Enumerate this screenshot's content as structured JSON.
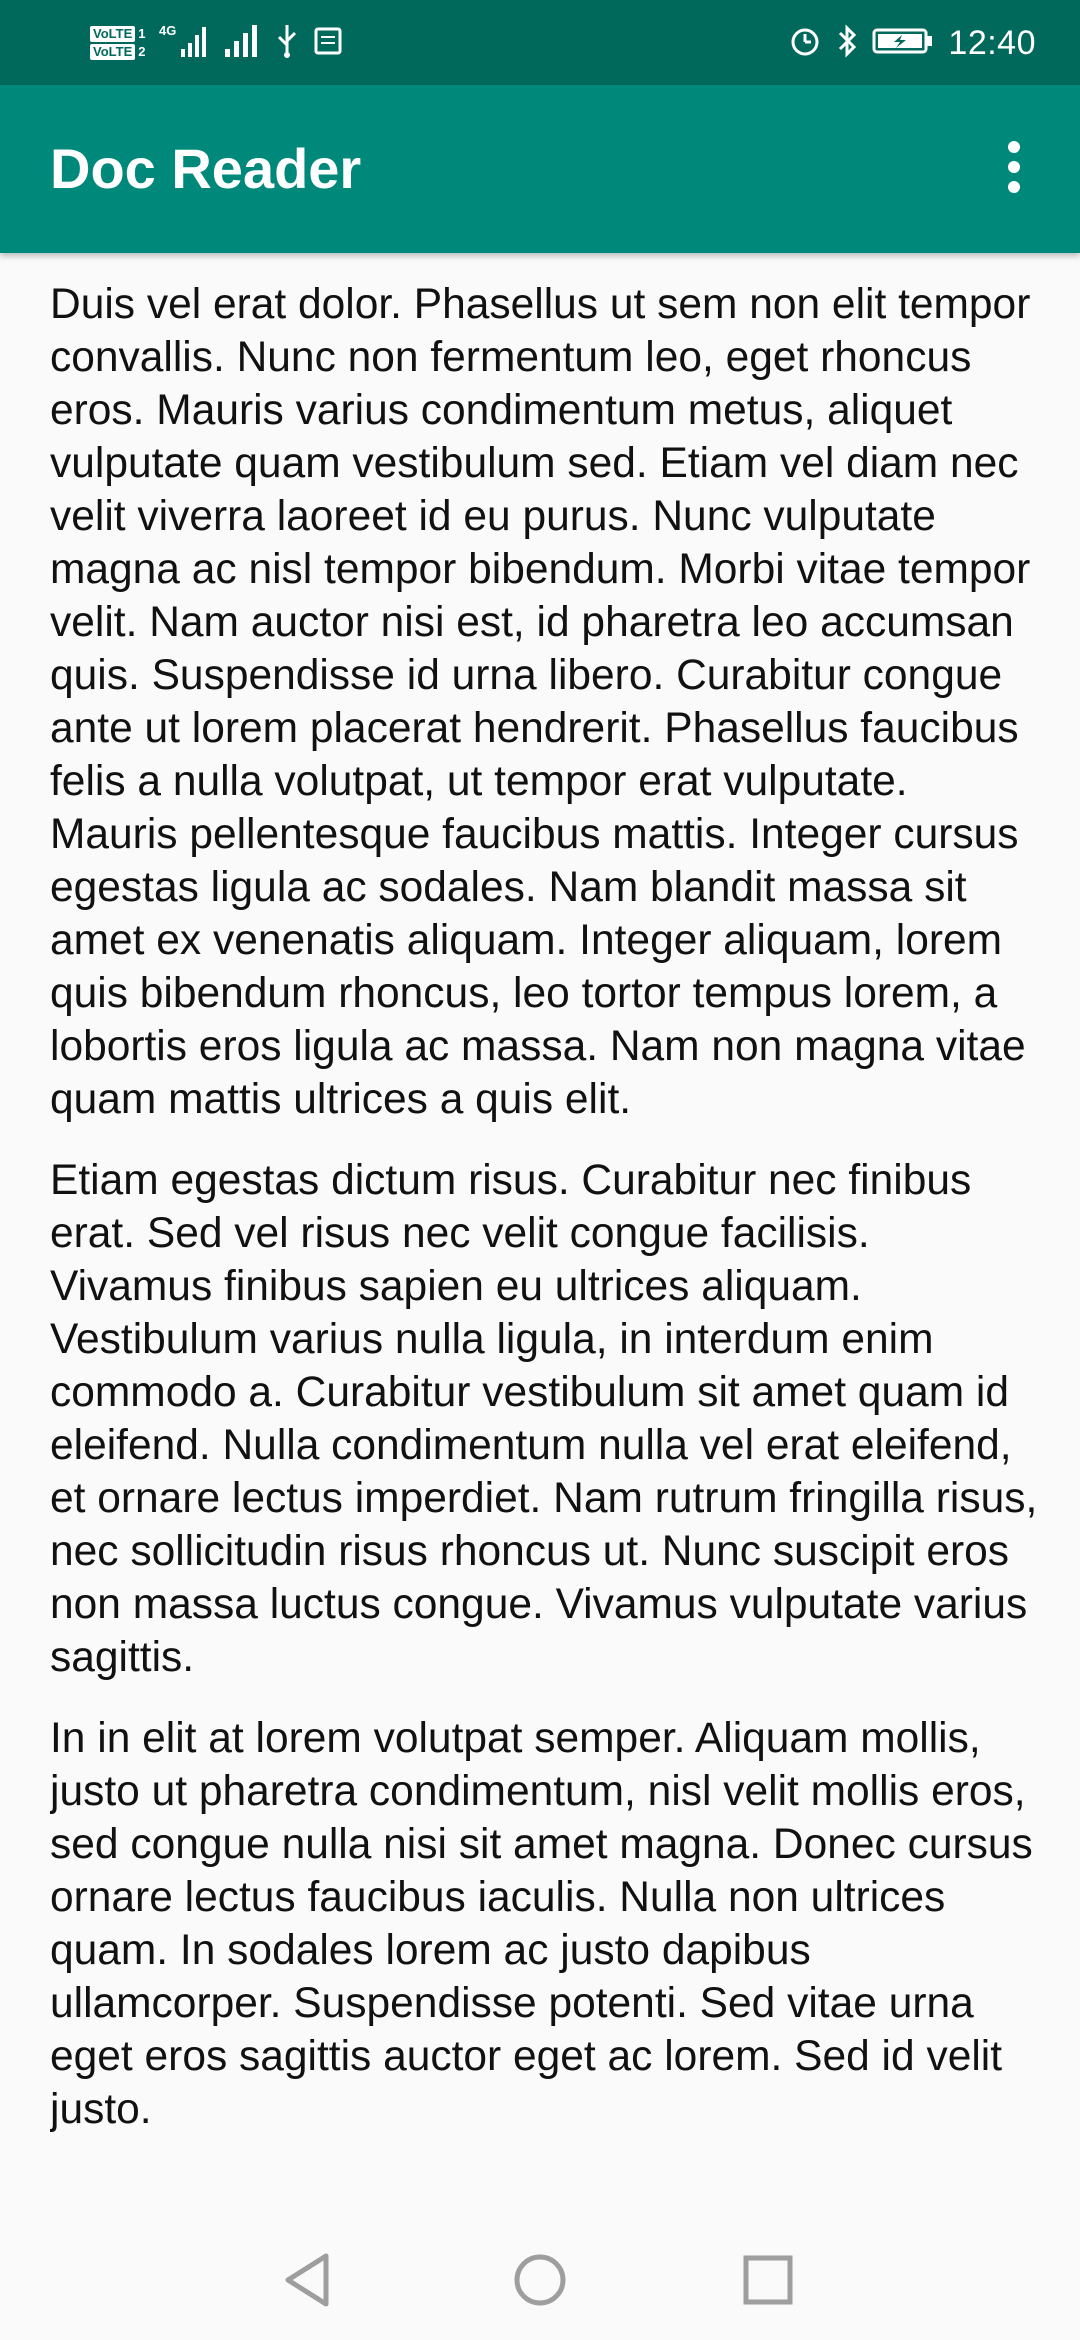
{
  "status_bar": {
    "sim1": "VoLTE 1",
    "sim2": "VoLTE 2",
    "network": "4G",
    "time": "12:40",
    "icons": [
      "volte-icon",
      "signal-4g-icon",
      "signal-icon",
      "usb-icon",
      "sim-card-icon",
      "alarm-icon",
      "bluetooth-icon",
      "battery-charging-icon"
    ]
  },
  "toolbar": {
    "title": "Doc Reader",
    "menu_icon": "more-vert-icon"
  },
  "document": {
    "paragraphs": [
      "Duis vel erat dolor. Phasellus ut sem non elit tempor convallis. Nunc non fermentum leo, eget rhoncus eros. Mauris varius condimentum metus, aliquet vulputate quam vestibulum sed. Etiam vel diam nec velit viverra laoreet id eu purus. Nunc vulputate magna ac nisl tempor bibendum. Morbi vitae tempor velit. Nam auctor nisi est, id pharetra leo accumsan quis. Suspendisse id urna libero. Curabitur congue ante ut lorem placerat hendrerit. Phasellus faucibus felis a nulla volutpat, ut tempor erat vulputate. Mauris pellentesque faucibus mattis. Integer cursus egestas ligula ac sodales. Nam blandit massa sit amet ex venenatis aliquam. Integer aliquam, lorem quis bibendum rhoncus, leo tortor tempus lorem, a lobortis eros ligula ac massa. Nam non magna vitae quam mattis ultrices a quis elit.",
      "Etiam egestas dictum risus. Curabitur nec finibus erat. Sed vel risus nec velit congue facilisis. Vivamus finibus sapien eu ultrices aliquam. Vestibulum varius nulla ligula, in interdum enim commodo a. Curabitur vestibulum sit amet quam id eleifend. Nulla condimentum nulla vel erat eleifend, et ornare lectus imperdiet. Nam rutrum fringilla risus, nec sollicitudin risus rhoncus ut. Nunc suscipit eros non massa luctus congue. Vivamus vulputate varius sagittis.",
      "In in elit at lorem volutpat semper. Aliquam mollis, justo ut pharetra condimentum, nisl velit mollis eros, sed congue nulla nisi sit amet magna. Donec cursus ornare lectus faucibus iaculis. Nulla non ultrices quam. In sodales lorem ac justo dapibus ullamcorper. Suspendisse potenti. Sed vitae urna eget eros sagittis auctor eget ac lorem. Sed id velit justo."
    ]
  },
  "nav_bar": {
    "back_icon": "back-icon",
    "home_icon": "home-icon",
    "recents_icon": "recents-icon"
  },
  "colors": {
    "status_bar": "#00695c",
    "toolbar": "#00897b",
    "background": "#fafafa",
    "text": "#111111"
  }
}
